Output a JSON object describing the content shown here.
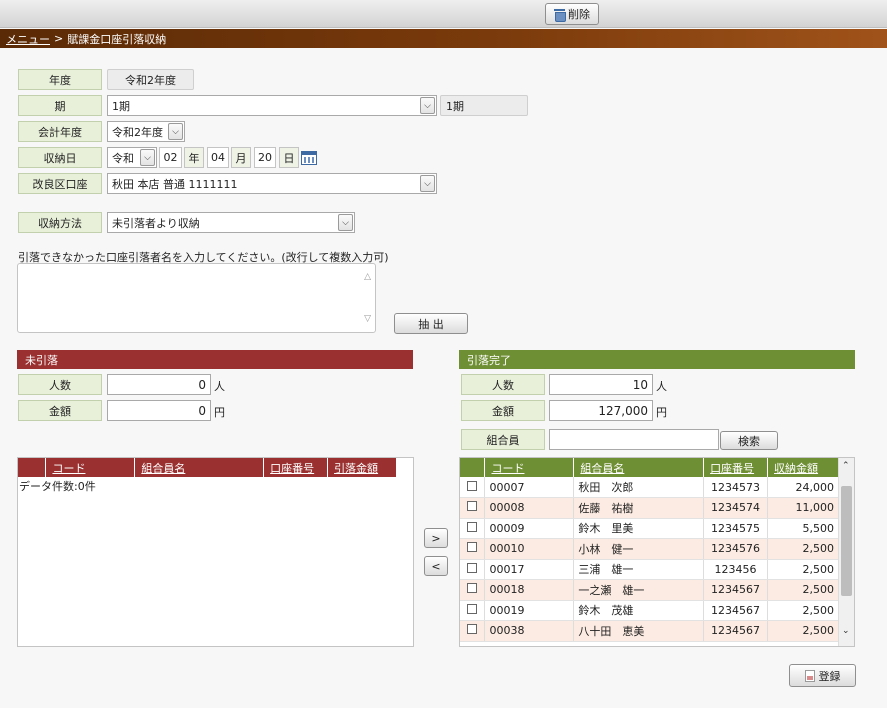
{
  "toolbar": {
    "delete_label": "削除",
    "delete_icon": "trash-icon"
  },
  "breadcrumb": {
    "menu_link": "メニュー",
    "separator": ">",
    "current": "賦課金口座引落収納"
  },
  "form": {
    "fiscal_year": {
      "label": "年度",
      "value": "令和2年度"
    },
    "period": {
      "label": "期",
      "value": "1期",
      "display": "1期"
    },
    "accounting_year": {
      "label": "会計年度",
      "value": "令和2年度"
    },
    "receipt_date": {
      "label": "収納日",
      "era": "令和",
      "year": "02",
      "year_unit": "年",
      "month": "04",
      "month_unit": "月",
      "day": "20",
      "day_unit": "日",
      "calendar_icon": "calendar-icon"
    },
    "account": {
      "label": "改良区口座",
      "value": "秋田 本店 普通 1111111"
    },
    "method": {
      "label": "収納方法",
      "value": "未引落者より収納"
    },
    "instruction": "引落できなかった口座引落者名を入力してください。(改行して複数入力可)",
    "extract_label": "抽 出"
  },
  "unpaid": {
    "title": "未引落",
    "count_label": "人数",
    "count_value": "0",
    "count_unit": "人",
    "amount_label": "金額",
    "amount_value": "0",
    "amount_unit": "円",
    "columns": [
      "コード",
      "組合員名",
      "口座番号",
      "引落金額"
    ],
    "empty_message": "データ件数:0件"
  },
  "completed": {
    "title": "引落完了",
    "count_label": "人数",
    "count_value": "10",
    "count_unit": "人",
    "amount_label": "金額",
    "amount_value": "127,000",
    "amount_unit": "円",
    "member_label": "組合員",
    "member_value": "",
    "search_label": "検索",
    "columns": [
      "コード",
      "組合員名",
      "口座番号",
      "収納金額"
    ],
    "rows": [
      {
        "code": "00007",
        "name": "秋田　次郎",
        "account": "1234573",
        "amount": "24,000"
      },
      {
        "code": "00008",
        "name": "佐藤　祐樹",
        "account": "1234574",
        "amount": "11,000"
      },
      {
        "code": "00009",
        "name": "鈴木　里美",
        "account": "1234575",
        "amount": "5,500"
      },
      {
        "code": "00010",
        "name": "小林　健一",
        "account": "1234576",
        "amount": "2,500"
      },
      {
        "code": "00017",
        "name": "三浦　雄一",
        "account": "123456",
        "amount": "2,500"
      },
      {
        "code": "00018",
        "name": "一之瀬　雄一",
        "account": "1234567",
        "amount": "2,500"
      },
      {
        "code": "00019",
        "name": "鈴木　茂雄",
        "account": "1234567",
        "amount": "2,500"
      },
      {
        "code": "00038",
        "name": "八十田　恵美",
        "account": "1234567",
        "amount": "2,500"
      }
    ]
  },
  "move_right_label": ">",
  "move_left_label": "<",
  "register_label": "登録",
  "colors": {
    "unpaid_header": "#9b3030",
    "completed_header": "#6f8f34",
    "label_bg": "#e8f0da",
    "breadcrumb_bar": "#7a3a0b"
  }
}
